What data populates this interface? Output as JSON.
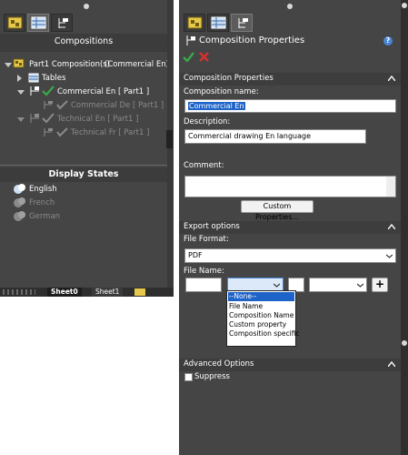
{
  "left_panel": {
    "title": "Compositions",
    "tree": {
      "root_label": "Part1 Composition(s)",
      "root_value": "(Commercial En)",
      "tables_label": "Tables",
      "commercial_en": "Commercial En [ Part1 ]",
      "commercial_de": "Commercial De [ Part1 ]",
      "technical_en": "Technical En [ Part1 ]",
      "technical_fr": "Technical Fr [ Part1 ]"
    },
    "display_states_title": "Display States",
    "display_states": [
      "English",
      "French",
      "German"
    ],
    "sheet_tabs": [
      "Sheet0",
      "Sheet1"
    ]
  },
  "right_panel": {
    "title": "Composition Properties",
    "help_icon": "?",
    "section_composition": "Composition Properties",
    "composition_name_label": "Composition name:",
    "composition_name_value": "Commercial En",
    "description_label": "Description:",
    "description_value": "Commercial drawing En language",
    "comment_label": "Comment:",
    "comment_value": "",
    "custom_properties_button": "Custom Properties...",
    "section_export": "Export options",
    "file_format_label": "File Format:",
    "file_format_value": "PDF",
    "file_name_label": "File Name:",
    "add_button": "+",
    "dropdown_options": [
      "--None--",
      "File Name",
      "Composition Name",
      "Custom property",
      "Composition specific"
    ],
    "section_advanced": "Advanced Options",
    "suppress_label": "Suppress"
  },
  "colors": {
    "panel_bg": "#454545",
    "header_bg": "#3d3d3d",
    "accent_blue": "#1e64c8",
    "check_green": "#3aa84a",
    "cross_red": "#d83030"
  }
}
